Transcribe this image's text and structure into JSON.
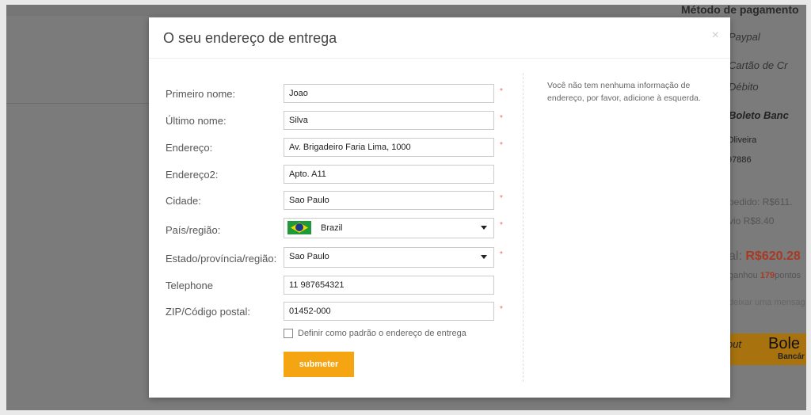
{
  "background": {
    "payment_title": "Método de pagamento",
    "methods": [
      "Paypal",
      "Cartão de Cr",
      "Débito",
      "Boleto Banc"
    ],
    "name_field": "Oliveira",
    "phone_field": "97886",
    "order_total_label": "pedido: R$611.",
    "shipping_label": "vio R$8.40",
    "total_label": "al:",
    "total_value": "R$620.28",
    "points_prefix": "ganhou ",
    "points_value": "179",
    "points_suffix": "pontos",
    "message_placeholder": "deixar uma mensag",
    "checkout_button": "out",
    "checkout_brand": "Bole",
    "checkout_brand_sub": "Bancár"
  },
  "modal": {
    "title": "O seu endereço de entrega",
    "close": "×",
    "info_text": "Você não tem nenhuma informação de endereço, por favor, adicione à esquerda.",
    "fields": [
      {
        "label": "Primeiro nome:",
        "value": "Joao",
        "required": true
      },
      {
        "label": "Último nome:",
        "value": "Silva",
        "required": true
      },
      {
        "label": "Endereço:",
        "value": "Av. Brigadeiro Faria Lima, 1000",
        "required": true
      },
      {
        "label": "Endereço2:",
        "value": "Apto. A11",
        "required": false
      },
      {
        "label": "Cidade:",
        "value": "Sao Paulo",
        "required": true
      },
      {
        "label": "País/região:",
        "value": "Brazil",
        "required": true
      },
      {
        "label": "Estado/província/região:",
        "value": "Sao Paulo",
        "required": true
      },
      {
        "label": "Telephone",
        "value": "11 987654321",
        "required": false
      },
      {
        "label": "ZIP/Código postal:",
        "value": "01452-000",
        "required": true
      }
    ],
    "required_mark": "*",
    "default_checkbox": "Definir como padrão o endereço de entrega",
    "submit": "submeter"
  },
  "colors": {
    "accent": "#f5a511",
    "price": "#c0392b"
  }
}
